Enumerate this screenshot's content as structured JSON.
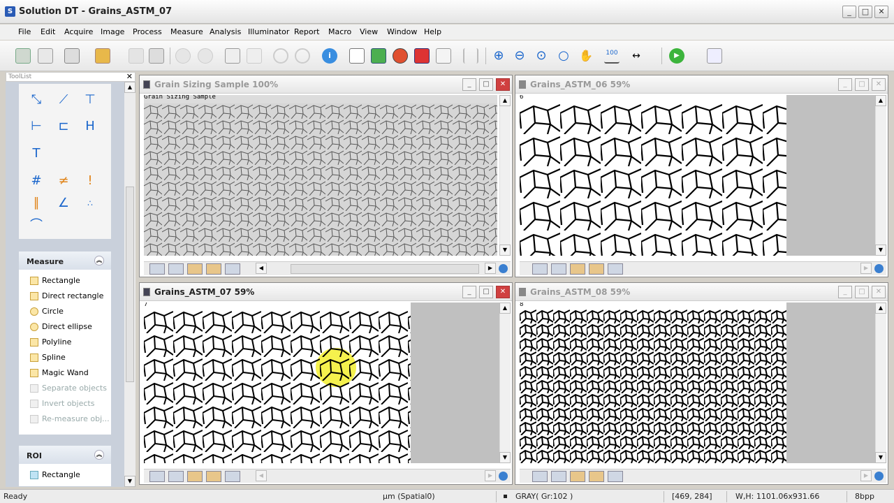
{
  "app": {
    "title": "Solution DT - Grains_ASTM_07",
    "icon": "app-icon"
  },
  "menu": [
    "File",
    "Edit",
    "Acquire",
    "Image",
    "Process",
    "Measure",
    "Analysis",
    "Illuminator",
    "Report",
    "Macro",
    "View",
    "Window",
    "Help"
  ],
  "toollist": {
    "title": "ToolList"
  },
  "measure_panel": {
    "title": "Measure",
    "items": [
      {
        "label": "Rectangle",
        "enabled": true
      },
      {
        "label": "Direct rectangle",
        "enabled": true
      },
      {
        "label": "Circle",
        "enabled": true
      },
      {
        "label": "Direct ellipse",
        "enabled": true
      },
      {
        "label": "Polyline",
        "enabled": true
      },
      {
        "label": "Spline",
        "enabled": true
      },
      {
        "label": "Magic Wand",
        "enabled": true
      },
      {
        "label": "Separate objects",
        "enabled": false
      },
      {
        "label": "Invert objects",
        "enabled": false
      },
      {
        "label": "Re-measure obj...",
        "enabled": false
      }
    ]
  },
  "roi_panel": {
    "title": "ROI",
    "items": [
      {
        "label": "Rectangle"
      }
    ]
  },
  "windows": [
    {
      "title": "Grain Sizing Sample 100%",
      "active": false,
      "label": "Grain Sizing Sample"
    },
    {
      "title": "Grains_ASTM_06 59%",
      "active": false,
      "label": "6"
    },
    {
      "title": "Grains_ASTM_07 59%",
      "active": true,
      "label": "7"
    },
    {
      "title": "Grains_ASTM_08 59%",
      "active": false,
      "label": "8"
    }
  ],
  "status": {
    "ready": "Ready",
    "units": "µm (Spatial0)",
    "pixel": "GRAY( Gr:102 )",
    "coords": "[469, 284]",
    "size": "W,H: 1101.06x931.66",
    "bpp": "8bpp"
  },
  "colors": {
    "selection": "#f4ef3a",
    "accent": "#1a66cc",
    "close": "#d04040"
  }
}
